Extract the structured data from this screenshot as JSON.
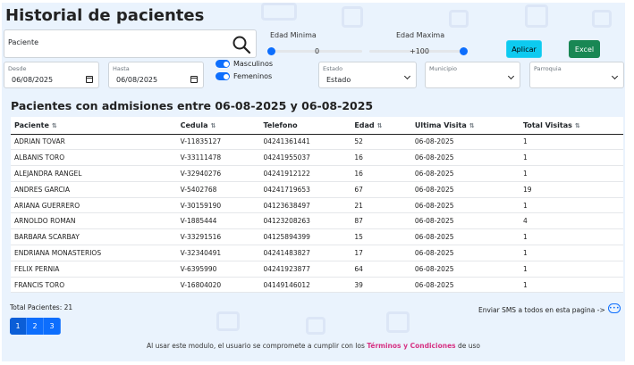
{
  "title": "Historial de pacientes",
  "search": {
    "value": "Paciente"
  },
  "age_min": {
    "label": "Edad Minima",
    "value": "0"
  },
  "age_max": {
    "label": "Edad Maxima",
    "value": "+100"
  },
  "buttons": {
    "apply": "Aplicar",
    "excel": "Excel"
  },
  "filters": {
    "desde": {
      "label": "Desde",
      "value": "06/08/2025"
    },
    "hasta": {
      "label": "Hasta",
      "value": "06/08/2025"
    },
    "gender": {
      "male": "Masculinos",
      "female": "Femeninos"
    },
    "estado": {
      "label": "Estado",
      "value": "Estado"
    },
    "municipio": {
      "label": "Municipio",
      "value": ""
    },
    "parroquia": {
      "label": "Parroquia",
      "value": ""
    }
  },
  "table_title": "Pacientes con admisiones entre 06-08-2025 y 06-08-2025",
  "columns": [
    "Paciente",
    "Cedula",
    "Telefono",
    "Edad",
    "Ultima Visita",
    "Total Visitas"
  ],
  "sortable": [
    true,
    true,
    false,
    true,
    true,
    true
  ],
  "rows": [
    [
      "ADRIAN TOVAR",
      "V-11835127",
      "04241361441",
      "52",
      "06-08-2025",
      "1"
    ],
    [
      "ALBANIS TORO",
      "V-33111478",
      "04241955037",
      "16",
      "06-08-2025",
      "1"
    ],
    [
      "ALEJANDRA RANGEL",
      "V-32940276",
      "04241912122",
      "16",
      "06-08-2025",
      "1"
    ],
    [
      "ANDRES GARCIA",
      "V-5402768",
      "04241719653",
      "67",
      "06-08-2025",
      "19"
    ],
    [
      "ARIANA GUERRERO",
      "V-30159190",
      "04123638497",
      "21",
      "06-08-2025",
      "1"
    ],
    [
      "ARNOLDO ROMAN",
      "V-1885444",
      "04123208263",
      "87",
      "06-08-2025",
      "4"
    ],
    [
      "BARBARA SCARBAY",
      "V-33291516",
      "04125894399",
      "15",
      "06-08-2025",
      "1"
    ],
    [
      "ENDRIANA MONASTERIOS",
      "V-32340491",
      "04241483827",
      "17",
      "06-08-2025",
      "1"
    ],
    [
      "FELIX PERNIA",
      "V-6395990",
      "04241923877",
      "64",
      "06-08-2025",
      "1"
    ],
    [
      "FRANCIS TORO",
      "V-16804020",
      "04149146012",
      "39",
      "06-08-2025",
      "1"
    ]
  ],
  "total_label": "Total Pacientes: 21",
  "sms_label": "Enviar SMS a todos en esta pagina ->",
  "pages": [
    "1",
    "2",
    "3"
  ],
  "footer": {
    "prefix": "Al usar este modulo, el usuario se compromete a cumplir con los ",
    "link": "Términos y Condiciones",
    "suffix": " de uso"
  }
}
